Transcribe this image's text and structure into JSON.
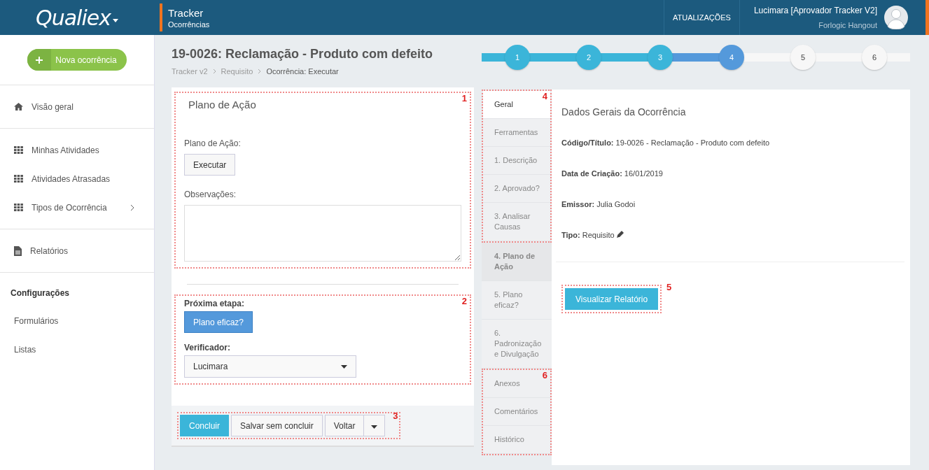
{
  "header": {
    "logo": "Qualiex",
    "app_title": "Tracker",
    "app_subtitle": "Ocorrências",
    "updates": "ATUALIZAÇÕES",
    "user_name": "Lucimara [Aprovador Tracker V2]",
    "user_org": "Forlogic Hangout"
  },
  "sidebar": {
    "new_button": "Nova ocorrência",
    "sections": [
      {
        "items": [
          {
            "label": "Visão geral",
            "kind": "home",
            "expandable": false
          }
        ]
      },
      {
        "items": [
          {
            "label": "Minhas Atividades",
            "kind": "grid",
            "expandable": false
          },
          {
            "label": "Atividades Atrasadas",
            "kind": "grid",
            "expandable": false
          },
          {
            "label": "Tipos de Ocorrência",
            "kind": "grid",
            "expandable": true
          }
        ]
      },
      {
        "items": [
          {
            "label": "Relatórios",
            "kind": "document",
            "expandable": false
          }
        ]
      },
      {
        "heading": "Configurações",
        "items": [
          {
            "label": "Formulários",
            "kind": "plain",
            "expandable": false
          },
          {
            "label": "Listas",
            "kind": "plain",
            "expandable": false
          }
        ]
      }
    ]
  },
  "page": {
    "title": "19-0026: Reclamação - Produto com defeito",
    "breadcrumb": [
      "Tracker v2",
      "Requisito",
      "Ocorrência: Executar"
    ]
  },
  "form": {
    "section1": {
      "callout": "1",
      "heading": "Plano de Ação",
      "plan_label": "Plano de Ação:",
      "plan_button": "Executar",
      "notes_label": "Observações:"
    },
    "section2": {
      "callout": "2",
      "next_label": "Próxima etapa:",
      "next_button": "Plano eficaz?",
      "verifier_label": "Verificador:",
      "verifier_value": "Lucimara"
    },
    "actions": {
      "callout": "3",
      "buttons": [
        {
          "label": "Concluir",
          "kind": "primary"
        },
        {
          "label": "Salvar sem concluir",
          "kind": "default"
        },
        {
          "label": "Voltar",
          "kind": "split"
        }
      ]
    }
  },
  "steps": [
    {
      "label": "1",
      "completed": true,
      "selected": false
    },
    {
      "label": "2",
      "completed": true,
      "selected": false
    },
    {
      "label": "3",
      "completed": true,
      "selected": false
    },
    {
      "label": "4",
      "completed": false,
      "selected": true
    },
    {
      "label": "5",
      "completed": false,
      "selected": false
    },
    {
      "label": "6",
      "completed": false,
      "selected": false
    }
  ],
  "tab_groups": [
    {
      "callout": "4",
      "tabs": [
        {
          "label": "Geral",
          "selected": true,
          "current": false
        },
        {
          "label": "Ferramentas",
          "selected": false,
          "current": false
        },
        {
          "label": "1. Descrição",
          "selected": false,
          "current": false
        },
        {
          "label": "2. Aprovado?",
          "selected": false,
          "current": false
        },
        {
          "label": "3. Analisar Causas",
          "selected": false,
          "current": false
        }
      ]
    },
    {
      "tabs": [
        {
          "label": "4. Plano de Ação",
          "selected": false,
          "current": true
        },
        {
          "label": "5. Plano eficaz?",
          "selected": false,
          "current": false
        },
        {
          "label": "6. Padronização e Divulgação",
          "selected": false,
          "current": false
        }
      ]
    },
    {
      "callout": "6",
      "tabs": [
        {
          "label": "Anexos",
          "selected": false,
          "current": false
        },
        {
          "label": "Comentários",
          "selected": false,
          "current": false
        },
        {
          "label": "Histórico",
          "selected": false,
          "current": false
        }
      ]
    }
  ],
  "details": {
    "heading": "Dados Gerais da Ocorrência",
    "fields": [
      {
        "label": "Código/Título:",
        "value": "19-0026 - Reclamação - Produto com defeito",
        "editable": false
      },
      {
        "label": "Data de Criação:",
        "value": "16/01/2019",
        "editable": false
      },
      {
        "label": "Emissor:",
        "value": "Julia Godoi",
        "editable": false
      },
      {
        "label": "Tipo:",
        "value": "Requisito",
        "editable": true
      }
    ],
    "report_button": {
      "label": "Visualizar Relatório",
      "callout": "5"
    }
  }
}
